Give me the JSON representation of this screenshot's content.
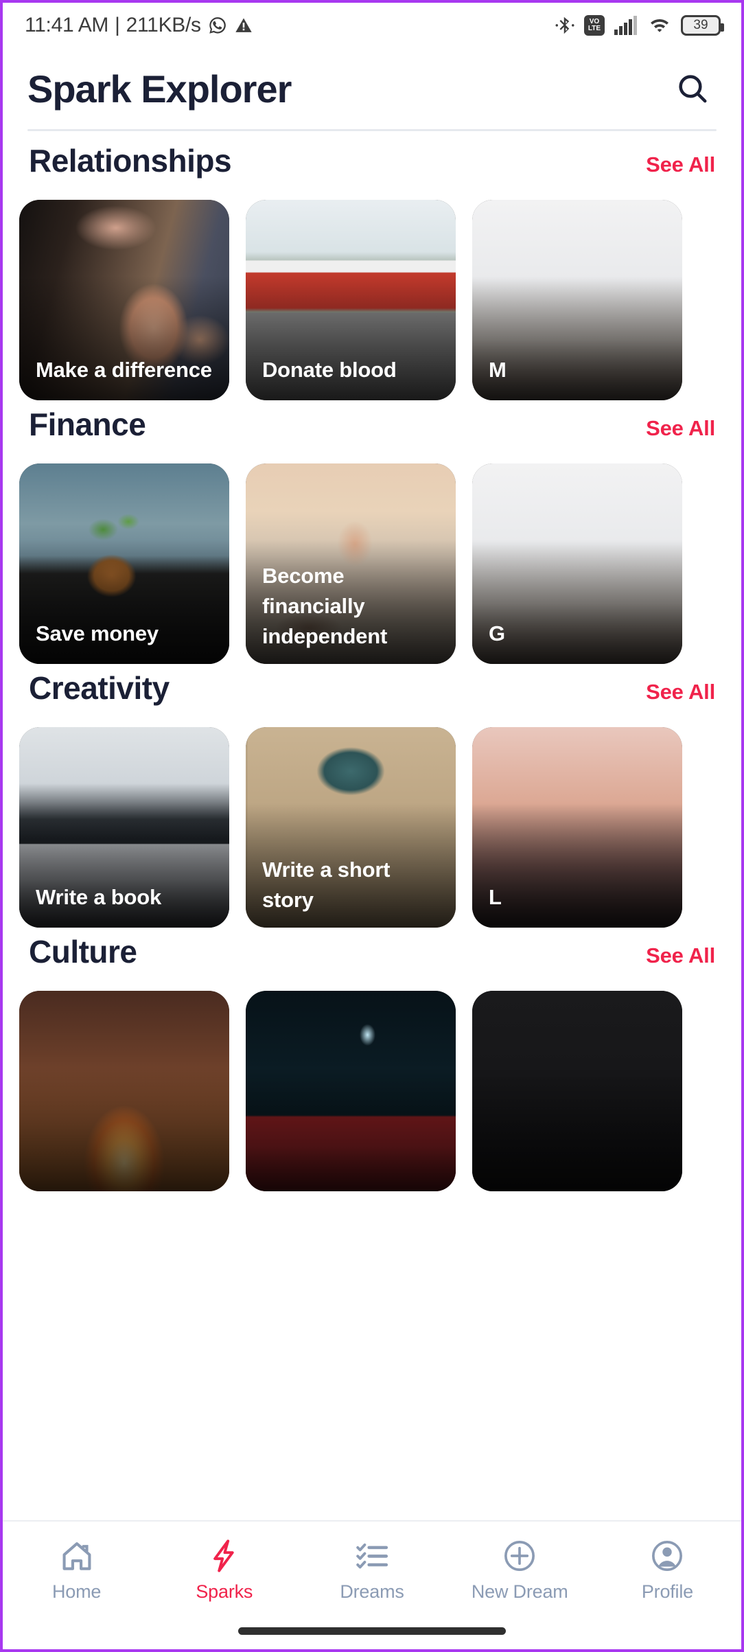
{
  "status_bar": {
    "clock": "11:41 AM",
    "separator": "|",
    "network_speed": "211KB/s",
    "whatsapp_icon": "whatsapp-icon",
    "warning_icon": "warning-triangle-icon",
    "bluetooth_icon": "bluetooth-icon",
    "volte_top": "VO",
    "volte_bottom": "LTE",
    "signal_icon": "cellular-signal-icon",
    "wifi_icon": "wifi-icon",
    "battery_level": "39"
  },
  "header": {
    "title": "Spark Explorer",
    "search_icon": "search-icon"
  },
  "colors": {
    "accent_red": "#f0234b",
    "title_navy": "#1b2036",
    "nav_inactive": "#8b9bb4",
    "divider": "#e6e9ee"
  },
  "sections": [
    {
      "title": "Relationships",
      "see_all": "See All",
      "cards": [
        {
          "label": "Make a difference",
          "photo": "ph-hands"
        },
        {
          "label": "Donate blood",
          "photo": "ph-bus"
        },
        {
          "label": "M",
          "photo": "ph-fade"
        }
      ]
    },
    {
      "title": "Finance",
      "see_all": "See All",
      "cards": [
        {
          "label": "Save money",
          "photo": "ph-plant"
        },
        {
          "label": "Become financially independent",
          "photo": "ph-beach"
        },
        {
          "label": "G",
          "photo": "ph-fade"
        }
      ]
    },
    {
      "title": "Creativity",
      "see_all": "See All",
      "cards": [
        {
          "label": "Write a book",
          "photo": "ph-laptop"
        },
        {
          "label": "Write a short story",
          "photo": "ph-typewriter"
        },
        {
          "label": "L",
          "photo": "ph-sunset"
        }
      ]
    },
    {
      "title": "Culture",
      "see_all": "See All",
      "cards": [
        {
          "label": "",
          "photo": "ph-fire"
        },
        {
          "label": "",
          "photo": "ph-theater"
        },
        {
          "label": "",
          "photo": "ph-dark"
        }
      ]
    }
  ],
  "bottom_nav": [
    {
      "label": "Home",
      "icon": "home-icon",
      "active": false
    },
    {
      "label": "Sparks",
      "icon": "lightning-bolt-icon",
      "active": true
    },
    {
      "label": "Dreams",
      "icon": "checklist-icon",
      "active": false
    },
    {
      "label": "New Dream",
      "icon": "plus-circle-icon",
      "active": false
    },
    {
      "label": "Profile",
      "icon": "person-circle-icon",
      "active": false
    }
  ]
}
